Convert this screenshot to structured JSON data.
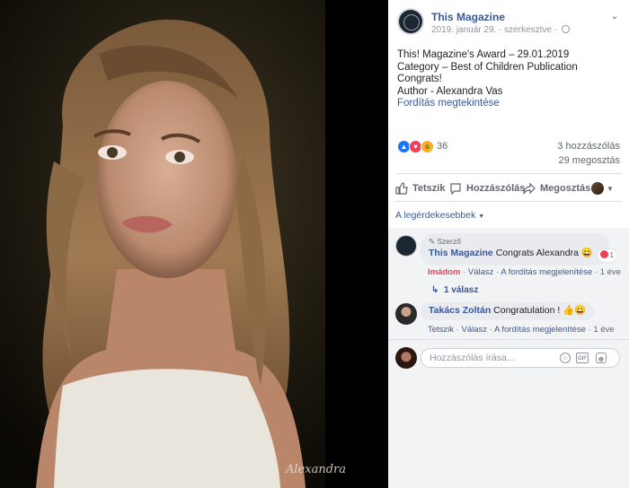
{
  "post": {
    "page_name": "This Magazine",
    "date": "2019. január 29.",
    "edited": "szerkesztve",
    "text_lines": [
      "This! Magazine's Award – 29.01.2019",
      "Category – Best of Children Publication",
      "Congrats!",
      "Author - Alexandra Vas"
    ],
    "translate": "Fordítás megtekintése",
    "reaction_count": "36",
    "comments_count": "3 hozzászólás",
    "shares_count": "29 megosztás",
    "signature": "Alexandra"
  },
  "actions": {
    "like": "Tetszik",
    "comment": "Hozzászólás",
    "share": "Megosztás"
  },
  "sort_label": "A legérdekesebbek",
  "comments": [
    {
      "badge": "Szerző",
      "author": "This Magazine",
      "text": "Congrats Alexandra",
      "emoji": "😀",
      "reaction_count": "1",
      "liked": "Imádom",
      "reply": "Válasz",
      "translate": "A fordítás megjelenítése",
      "age": "1 éve",
      "replies": "1 válasz"
    },
    {
      "author": "Takács Zoltán",
      "text": "Congratulation !",
      "emoji": "👍😀",
      "like": "Tetszik",
      "reply": "Válasz",
      "translate": "A fordítás megjelenítése",
      "age": "1 éve"
    }
  ],
  "composer": {
    "placeholder": "Hozzászólás írása...",
    "gif": "GIF"
  },
  "colors": {
    "link": "#385898",
    "love": "#f33e58",
    "like": "#1877f2",
    "panel": "#ffffff",
    "comment_bg": "#f2f3f5"
  }
}
